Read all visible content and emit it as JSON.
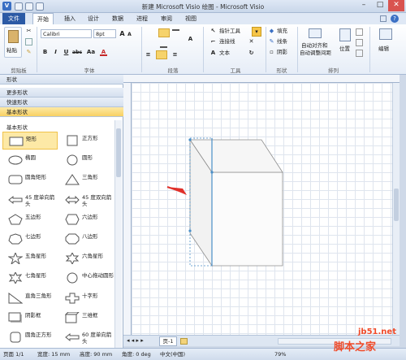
{
  "window": {
    "title": "新建 Microsoft Visio 绘图 - Microsoft Visio",
    "buttons": [
      "?",
      "–",
      "□",
      "✕"
    ]
  },
  "tabs": [
    {
      "label": "文件"
    },
    {
      "label": "开始"
    },
    {
      "label": "插入"
    },
    {
      "label": "设计"
    },
    {
      "label": "数据"
    },
    {
      "label": "进程"
    },
    {
      "label": "审阅"
    },
    {
      "label": "视图"
    }
  ],
  "ribbon": {
    "clipboard": {
      "paste": "粘贴",
      "label": "剪贴板"
    },
    "font": {
      "font_name": "Calibri",
      "font_size": "8pt",
      "bold": "B",
      "italic": "I",
      "underline": "U",
      "strike": "abc",
      "case": "Aa",
      "font_color": "A",
      "grow": "A",
      "shrink": "A",
      "label": "字体"
    },
    "paragraph": {
      "label": "段落"
    },
    "tools": {
      "pointer": "指针工具",
      "connector": "连接线",
      "text": "文本",
      "label": "工具"
    },
    "shape": {
      "fill": "填充",
      "line": "线条",
      "shadow": "阴影",
      "label": "形状"
    },
    "arrange": {
      "auto_align": "自动对齐和",
      "auto_space": "自动调整间距",
      "position": "位置",
      "label": "排列"
    },
    "edit": {
      "label": "编辑"
    }
  },
  "shapes_pane": {
    "title": "形状",
    "more": "更多形状",
    "quick": "快速形状",
    "basic_selected": "基本形状",
    "stencil_title": "基本形状",
    "items": [
      {
        "label": "矩形",
        "icon": "rect"
      },
      {
        "label": "正方形",
        "icon": "square"
      },
      {
        "label": "椭圆",
        "icon": "ellipse"
      },
      {
        "label": "圆形",
        "icon": "circle"
      },
      {
        "label": "圆角矩形",
        "icon": "rounded-rect"
      },
      {
        "label": "三角形",
        "icon": "triangle"
      },
      {
        "label": "45 度单向箭头",
        "icon": "arrow"
      },
      {
        "label": "45 度双向箭头",
        "icon": "double-arrow"
      },
      {
        "label": "五边形",
        "icon": "pentagon"
      },
      {
        "label": "六边形",
        "icon": "hexagon"
      },
      {
        "label": "七边形",
        "icon": "heptagon"
      },
      {
        "label": "八边形",
        "icon": "octagon"
      },
      {
        "label": "五角星形",
        "icon": "star5"
      },
      {
        "label": "六角星形",
        "icon": "star6"
      },
      {
        "label": "七角星形",
        "icon": "star7"
      },
      {
        "label": "中心拖动圆形",
        "icon": "circle-center"
      },
      {
        "label": "直角三角形",
        "icon": "right-triangle"
      },
      {
        "label": "十字形",
        "icon": "cross"
      },
      {
        "label": "阴影框",
        "icon": "shadow-box"
      },
      {
        "label": "三维框",
        "icon": "3d-box"
      },
      {
        "label": "圆角正方形",
        "icon": "rounded-square"
      },
      {
        "label": "60 度单向箭头",
        "icon": "arrow60"
      }
    ]
  },
  "canvas": {
    "page_tab": "页-1"
  },
  "status": {
    "page": "页面 1/1",
    "width": "宽度: 15 mm",
    "height": "高度: 90 mm",
    "angle": "角度: 0 deg",
    "lang": "中文(中国)",
    "zoom": "79%"
  },
  "watermark": {
    "site": "jb51.net",
    "brand": "脚本之家"
  },
  "colors": {
    "file_tab": "#2b5aa5",
    "selection": "#fde9a6",
    "arrow": "#e0302a"
  }
}
